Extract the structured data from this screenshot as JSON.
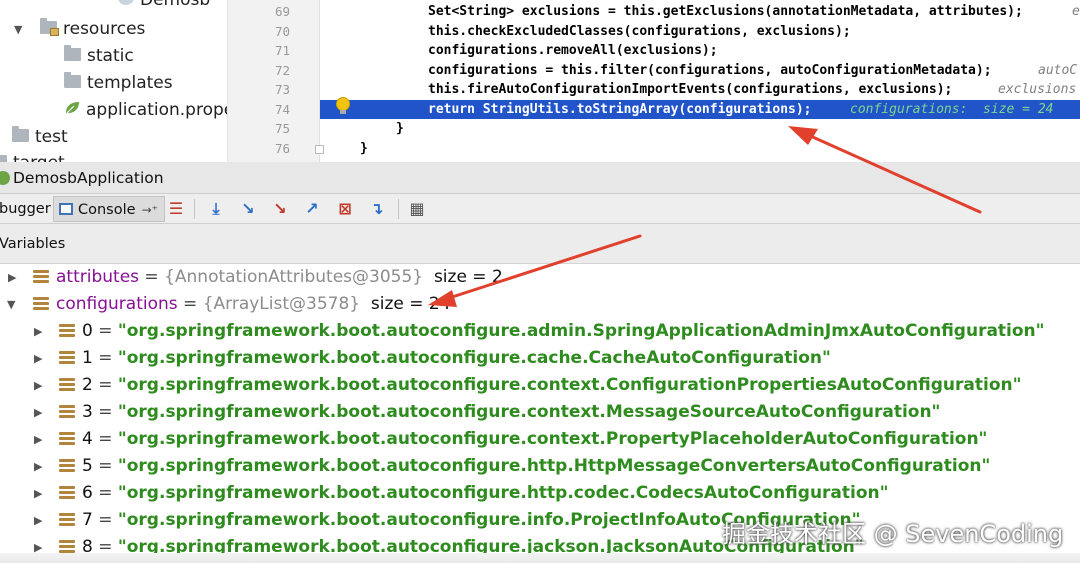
{
  "tree": {
    "items": [
      {
        "label": "Demosb",
        "type": "module"
      },
      {
        "label": "resources",
        "type": "folder",
        "expanded": true
      },
      {
        "label": "static",
        "type": "folder"
      },
      {
        "label": "templates",
        "type": "folder"
      },
      {
        "label": "application.prope",
        "type": "file"
      },
      {
        "label": "test",
        "type": "folder"
      },
      {
        "label": "target",
        "type": "folder"
      }
    ]
  },
  "editor": {
    "lines": [
      {
        "no": "69",
        "code": "Set<String> exclusions = this.getExclusions(annotationMetadata, attributes);",
        "hint": "e"
      },
      {
        "no": "70",
        "code": "this.checkExcludedClasses(configurations, exclusions);",
        "hint": ""
      },
      {
        "no": "71",
        "code": "configurations.removeAll(exclusions);",
        "hint": ""
      },
      {
        "no": "72",
        "code": "configurations = this.filter(configurations, autoConfigurationMetadata);",
        "hint": "autoC"
      },
      {
        "no": "73",
        "code": "this.fireAutoConfigurationImportEvents(configurations, exclusions);",
        "hint": "exclusions"
      },
      {
        "no": "74",
        "code": "return StringUtils.toStringArray(configurations);",
        "hint": "configurations:  size = 24"
      },
      {
        "no": "75",
        "code": "}",
        "hint": ""
      },
      {
        "no": "76",
        "code": "}",
        "hint": ""
      }
    ]
  },
  "debug": {
    "title": "DemosbApplication",
    "tab_debugger": "bugger",
    "tab_console": "Console",
    "variables_label": "Variables"
  },
  "variables": {
    "attributes": {
      "name": "attributes",
      "ref": "{AnnotationAttributes@3055}",
      "size": "size = 2"
    },
    "configurations": {
      "name": "configurations",
      "ref": "{ArrayList@3578}",
      "size": "size = 24"
    },
    "items": [
      {
        "index": "0",
        "value": "\"org.springframework.boot.autoconfigure.admin.SpringApplicationAdminJmxAutoConfiguration\""
      },
      {
        "index": "1",
        "value": "\"org.springframework.boot.autoconfigure.cache.CacheAutoConfiguration\""
      },
      {
        "index": "2",
        "value": "\"org.springframework.boot.autoconfigure.context.ConfigurationPropertiesAutoConfiguration\""
      },
      {
        "index": "3",
        "value": "\"org.springframework.boot.autoconfigure.context.MessageSourceAutoConfiguration\""
      },
      {
        "index": "4",
        "value": "\"org.springframework.boot.autoconfigure.context.PropertyPlaceholderAutoConfiguration\""
      },
      {
        "index": "5",
        "value": "\"org.springframework.boot.autoconfigure.http.HttpMessageConvertersAutoConfiguration\""
      },
      {
        "index": "6",
        "value": "\"org.springframework.boot.autoconfigure.http.codec.CodecsAutoConfiguration\""
      },
      {
        "index": "7",
        "value": "\"org.springframework.boot.autoconfigure.info.ProjectInfoAutoConfiguration\""
      },
      {
        "index": "8",
        "value": "\"org.springframework.boot.autoconfigure.jackson.JacksonAutoConfiguration\""
      }
    ]
  },
  "watermark": "掘金技术社区 @ SevenCoding",
  "colors": {
    "highlight_line": "#2154c8",
    "arrow": "#e0402c",
    "string_value": "#2e8b1e",
    "var_name": "#871094"
  }
}
